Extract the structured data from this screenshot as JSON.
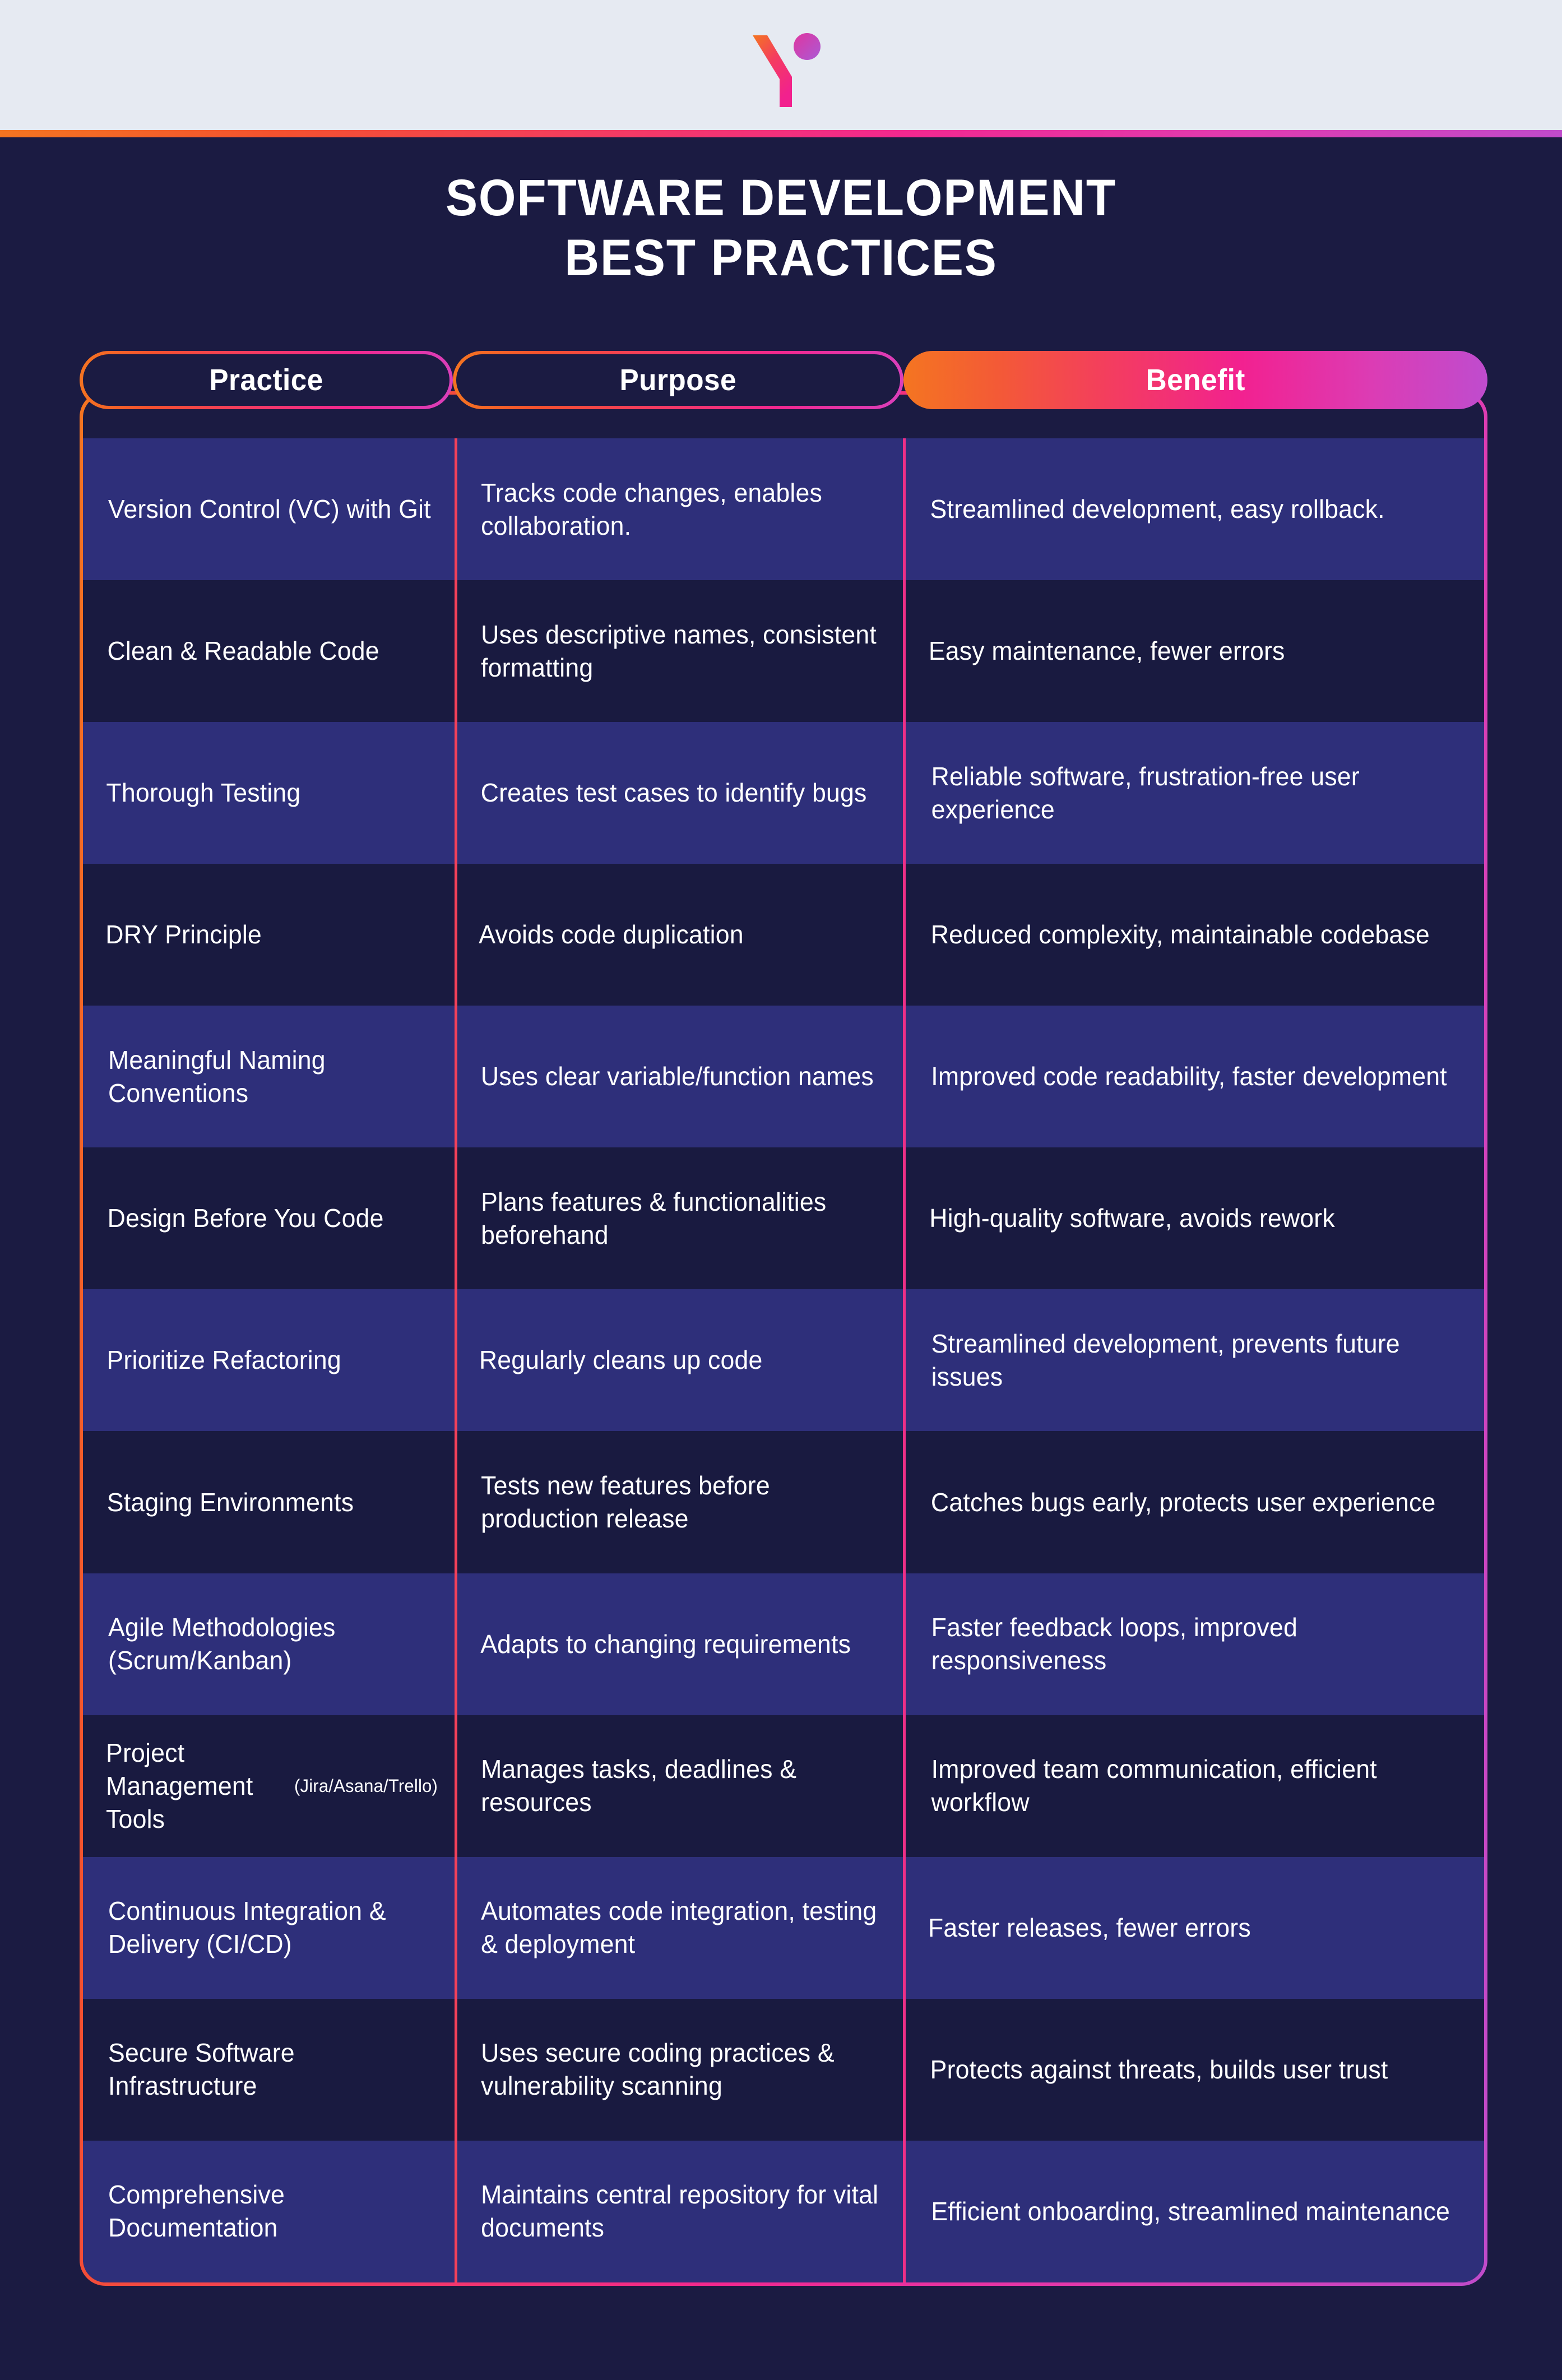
{
  "brand": {
    "logo_name": "y-letter-logo",
    "band_color": "#e6eaf2"
  },
  "title": {
    "line1": "SOFTWARE DEVELOPMENT",
    "line2": "BEST PRACTICES"
  },
  "colors": {
    "background": "#1b1b42",
    "row_light": "#2e2f7a",
    "row_dark": "#191a40",
    "gradient_start": "#f47521",
    "gradient_mid": "#f2218e",
    "gradient_end": "#c04bcb",
    "divider_practice_purpose": "#f4415a",
    "divider_purpose_benefit": "#ed2f87",
    "text": "#ffffff"
  },
  "table": {
    "headers": {
      "practice": "Practice",
      "purpose": "Purpose",
      "benefit": "Benefit"
    },
    "rows": [
      {
        "practice": "Version Control (VC) with Git",
        "purpose": "Tracks code changes, enables collaboration.",
        "benefit": "Streamlined development, easy rollback."
      },
      {
        "practice": "Clean & Readable Code",
        "purpose": "Uses descriptive names, consistent formatting",
        "benefit": "Easy maintenance, fewer errors"
      },
      {
        "practice": "Thorough Testing",
        "purpose": "Creates test cases to identify bugs",
        "benefit": "Reliable software, frustration-free user experience"
      },
      {
        "practice": "DRY Principle",
        "purpose": "Avoids code duplication",
        "benefit": "Reduced complexity, maintainable codebase"
      },
      {
        "practice": "Meaningful Naming Conventions",
        "purpose": "Uses clear variable/function names",
        "benefit": "Improved code readability, faster development"
      },
      {
        "practice": "Design Before You Code",
        "purpose": "Plans features & functionalities beforehand",
        "benefit": "High-quality software, avoids rework"
      },
      {
        "practice": "Prioritize Refactoring",
        "purpose": "Regularly cleans up code",
        "benefit": "Streamlined development, prevents future issues"
      },
      {
        "practice": "Staging Environments",
        "purpose": "Tests new features before production release",
        "benefit": "Catches bugs early, protects user experience"
      },
      {
        "practice": "Agile Methodologies (Scrum/Kanban)",
        "purpose": "Adapts to changing requirements",
        "benefit": "Faster feedback loops, improved responsiveness"
      },
      {
        "practice": "Project Management Tools ",
        "practice_sub": "(Jira/Asana/Trello)",
        "purpose": "Manages tasks, deadlines & resources",
        "benefit": "Improved team communication, efficient workflow"
      },
      {
        "practice": "Continuous Integration & Delivery (CI/CD)",
        "purpose": "Automates code integration, testing & deployment",
        "benefit": "Faster releases, fewer errors"
      },
      {
        "practice": "Secure Software Infrastructure",
        "purpose": "Uses secure coding practices & vulnerability scanning",
        "benefit": "Protects against threats, builds user trust"
      },
      {
        "practice": "Comprehensive Documentation",
        "purpose": "Maintains central repository for vital documents",
        "benefit": "Efficient onboarding, streamlined maintenance"
      }
    ]
  }
}
